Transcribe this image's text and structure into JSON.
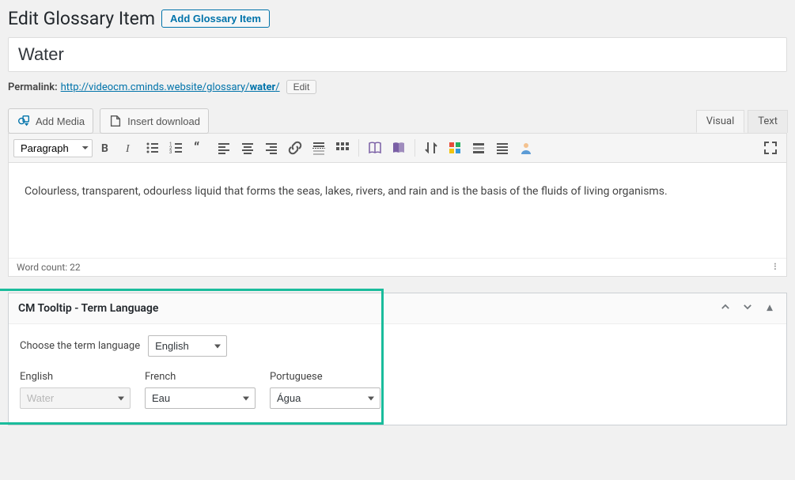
{
  "header": {
    "title": "Edit Glossary Item",
    "add_button": "Add Glossary Item"
  },
  "title_input": {
    "value": "Water"
  },
  "permalink": {
    "label": "Permalink:",
    "base": "http://videocm.cminds.website/glossary/",
    "slug": "water",
    "tail": "/",
    "edit": "Edit"
  },
  "media_buttons": {
    "add_media": "Add Media",
    "insert_download": "Insert download"
  },
  "editor_tabs": {
    "visual": "Visual",
    "text": "Text",
    "active": "visual"
  },
  "toolbar": {
    "format_select": "Paragraph"
  },
  "editor": {
    "content": "Colourless, transparent, odourless liquid that forms the seas, lakes, rivers, and rain and is the basis of the fluids of living organisms."
  },
  "statusbar": {
    "word_count": "Word count: 22"
  },
  "cm_tooltip": {
    "box_title": "CM Tooltip - Term Language",
    "choose_label": "Choose the term language",
    "language_select": "English",
    "cols": {
      "english": {
        "label": "English",
        "value": "Water"
      },
      "french": {
        "label": "French",
        "value": "Eau"
      },
      "portuguese": {
        "label": "Portuguese",
        "value": "Água"
      }
    }
  }
}
